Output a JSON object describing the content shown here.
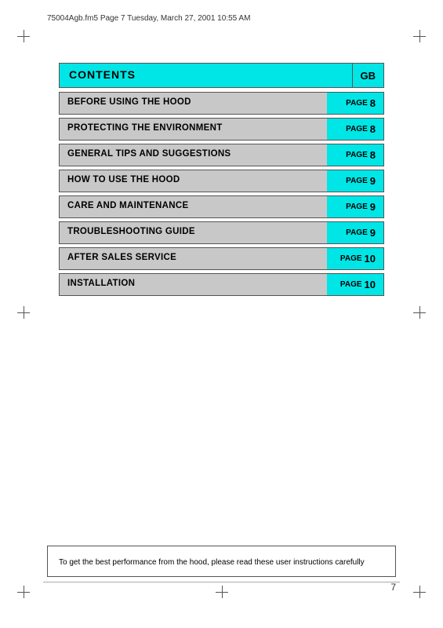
{
  "header": {
    "file_info": "75004Agb.fm5  Page 7  Tuesday, March 27, 2001  10:55 AM"
  },
  "contents": {
    "title": "CONTENTS",
    "gb_label": "GB",
    "rows": [
      {
        "label": "BEFORE USING THE HOOD",
        "page_label": "PAGE",
        "page_num": "8"
      },
      {
        "label": "PROTECTING THE ENVIRONMENT",
        "page_label": "PAGE",
        "page_num": "8"
      },
      {
        "label": "GENERAL TIPS AND SUGGESTIONS",
        "page_label": "PAGE",
        "page_num": "8"
      },
      {
        "label": "HOW TO USE THE HOOD",
        "page_label": "PAGE",
        "page_num": "9"
      },
      {
        "label": "CARE AND MAINTENANCE",
        "page_label": "PAGE",
        "page_num": "9"
      },
      {
        "label": "TROUBLESHOOTING GUIDE",
        "page_label": "PAGE",
        "page_num": "9"
      },
      {
        "label": "AFTER SALES SERVICE",
        "page_label": "PAGE",
        "page_num": "10"
      },
      {
        "label": "INSTALLATION",
        "page_label": "PAGE",
        "page_num": "10"
      }
    ]
  },
  "bottom_note": {
    "text": "To get the best performance from the hood, please read these user instructions carefully"
  },
  "page_number": "7"
}
